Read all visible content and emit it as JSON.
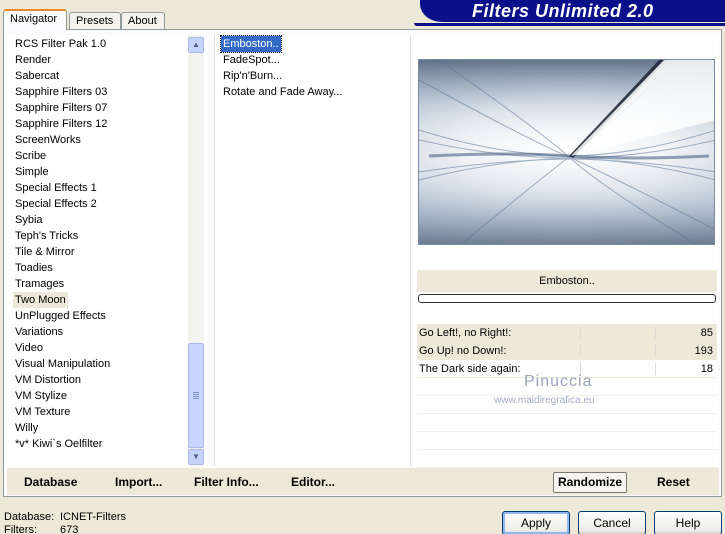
{
  "tabs": [
    "Navigator",
    "Presets",
    "About"
  ],
  "app_title": "Filters Unlimited 2.0",
  "categories": [
    "RCS Filter Pak 1.0",
    "Render",
    "Sabercat",
    "Sapphire Filters 03",
    "Sapphire Filters 07",
    "Sapphire Filters 12",
    "ScreenWorks",
    "Scribe",
    "Simple",
    "Special Effects 1",
    "Special Effects 2",
    "Sybia",
    "Teph's Tricks",
    "Tile & Mirror",
    "Toadies",
    "Tramages",
    "Two Moon",
    "UnPlugged Effects",
    "Variations",
    "Video",
    "Visual Manipulation",
    "VM Distortion",
    "VM Stylize",
    "VM Texture",
    "Willy",
    "*v* Kiwi`s Oelfilter"
  ],
  "selected_category": "Two Moon",
  "filters": [
    "Emboston..",
    "FadeSpot...",
    "Rip'n'Burn...",
    "Rotate and Fade Away..."
  ],
  "selected_filter": "Emboston..",
  "current_filter_name": "Emboston..",
  "params": [
    {
      "label": "Go Left!, no Right!:",
      "value": "85",
      "thumb_fraction": 0.333
    },
    {
      "label": "Go Up! no Down!:",
      "value": "193",
      "thumb_fraction": 0.757
    },
    {
      "label": "The Dark side again:",
      "value": "18",
      "thumb_fraction": null
    }
  ],
  "bottom_buttons": {
    "database": "Database",
    "import": "Import...",
    "filter_info": "Filter Info...",
    "editor": "Editor...",
    "randomize": "Randomize",
    "reset": "Reset"
  },
  "watermark": {
    "line1": "Pinuccia",
    "line2": "www.maidiregrafica.eu"
  },
  "status": {
    "database_label": "Database:",
    "database_value": "ICNET-Filters",
    "filters_label": "Filters:",
    "filters_value": "673"
  },
  "dialog_buttons": {
    "apply": "Apply",
    "cancel": "Cancel",
    "help": "Help"
  }
}
